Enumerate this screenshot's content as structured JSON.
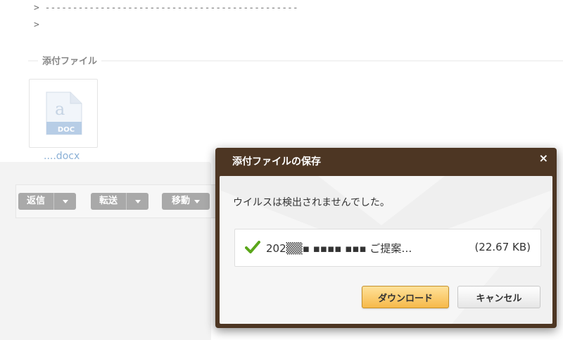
{
  "mail": {
    "quote_lines": [
      "> ----------------------------------------------",
      ">"
    ],
    "attachments_title": "添付ファイル",
    "attachment_name": "....docx",
    "file_icon_label": "DOC"
  },
  "toolbar": {
    "reply_label": "返信",
    "forward_label": "転送",
    "move_label": "移動"
  },
  "dialog": {
    "title": "添付ファイルの保存",
    "close_glyph": "×",
    "message": "ウイルスは検出されませんでした。",
    "file": {
      "name": "202▒▒▪ ▪▪▪▪ ▪▪▪ ご提案…",
      "size": "(22.67 KB)"
    },
    "download_label": "ダウンロード",
    "cancel_label": "キャンセル"
  },
  "colors": {
    "dialog_frame": "#4d3623",
    "primary_button": "#f6b94a",
    "check": "#5aa61a",
    "toolbar_button": "#a9a9a9",
    "link": "#8ab0d6"
  },
  "icons": {
    "file": "docx-file-icon",
    "check": "check-icon",
    "close": "close-icon",
    "dropdown": "caret-down-icon"
  }
}
